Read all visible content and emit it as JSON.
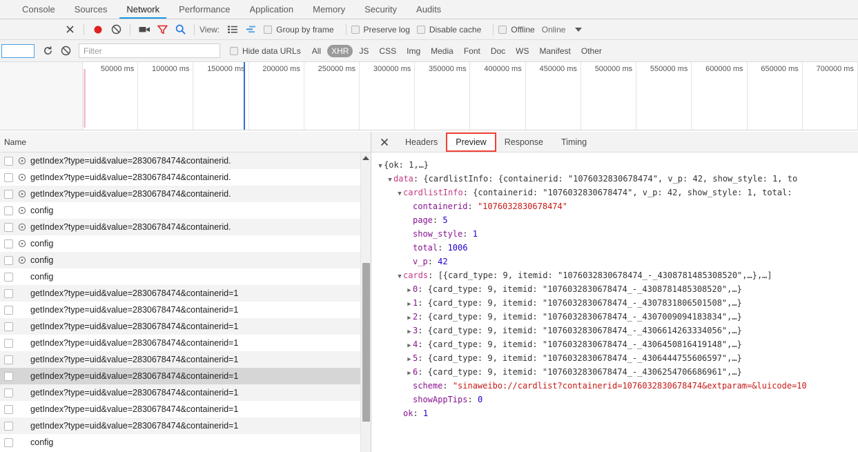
{
  "panel_tabs": [
    {
      "label": "Console",
      "active": false
    },
    {
      "label": "Sources",
      "active": false
    },
    {
      "label": "Network",
      "active": true
    },
    {
      "label": "Performance",
      "active": false
    },
    {
      "label": "Application",
      "active": false
    },
    {
      "label": "Memory",
      "active": false
    },
    {
      "label": "Security",
      "active": false
    },
    {
      "label": "Audits",
      "active": false
    }
  ],
  "toolbar": {
    "close_label": "✕",
    "record_title": "record",
    "clear_title": "clear",
    "capture_screenshots_title": "capture-screenshots",
    "filter_title": "filter",
    "search_title": "search",
    "view_label": "View:",
    "group_by_frame": "Group by frame",
    "preserve_log": "Preserve log",
    "disable_cache": "Disable cache",
    "offline": "Offline",
    "online": "Online"
  },
  "filterbar": {
    "reload_title": "reload",
    "clear_title": "clear",
    "filter_placeholder": "Filter",
    "filter_value": "",
    "hide_data_urls": "Hide data URLs",
    "types": [
      {
        "label": "All",
        "selected": false
      },
      {
        "label": "XHR",
        "selected": true
      },
      {
        "label": "JS",
        "selected": false
      },
      {
        "label": "CSS",
        "selected": false
      },
      {
        "label": "Img",
        "selected": false
      },
      {
        "label": "Media",
        "selected": false
      },
      {
        "label": "Font",
        "selected": false
      },
      {
        "label": "Doc",
        "selected": false
      },
      {
        "label": "WS",
        "selected": false
      },
      {
        "label": "Manifest",
        "selected": false
      },
      {
        "label": "Other",
        "selected": false
      }
    ]
  },
  "overview": {
    "ticks": [
      "50000 ms",
      "100000 ms",
      "150000 ms",
      "200000 ms",
      "250000 ms",
      "300000 ms",
      "350000 ms",
      "400000 ms",
      "450000 ms",
      "500000 ms",
      "550000 ms",
      "600000 ms",
      "650000 ms",
      "700000 ms"
    ]
  },
  "request_list": {
    "column_header": "Name",
    "rows": [
      {
        "name": "getIndex?type=uid&value=2830678474&containerid.",
        "has_icon": true,
        "selected": false
      },
      {
        "name": "getIndex?type=uid&value=2830678474&containerid.",
        "has_icon": true,
        "selected": false
      },
      {
        "name": "getIndex?type=uid&value=2830678474&containerid.",
        "has_icon": true,
        "selected": false
      },
      {
        "name": "config",
        "has_icon": true,
        "selected": false
      },
      {
        "name": "getIndex?type=uid&value=2830678474&containerid.",
        "has_icon": true,
        "selected": false
      },
      {
        "name": "config",
        "has_icon": true,
        "selected": false
      },
      {
        "name": "config",
        "has_icon": true,
        "selected": false
      },
      {
        "name": "config",
        "has_icon": false,
        "selected": false
      },
      {
        "name": "getIndex?type=uid&value=2830678474&containerid=1",
        "has_icon": false,
        "selected": false
      },
      {
        "name": "getIndex?type=uid&value=2830678474&containerid=1",
        "has_icon": false,
        "selected": false
      },
      {
        "name": "getIndex?type=uid&value=2830678474&containerid=1",
        "has_icon": false,
        "selected": false
      },
      {
        "name": "getIndex?type=uid&value=2830678474&containerid=1",
        "has_icon": false,
        "selected": false
      },
      {
        "name": "getIndex?type=uid&value=2830678474&containerid=1",
        "has_icon": false,
        "selected": false
      },
      {
        "name": "getIndex?type=uid&value=2830678474&containerid=1",
        "has_icon": false,
        "selected": true
      },
      {
        "name": "getIndex?type=uid&value=2830678474&containerid=1",
        "has_icon": false,
        "selected": false
      },
      {
        "name": "getIndex?type=uid&value=2830678474&containerid=1",
        "has_icon": false,
        "selected": false
      },
      {
        "name": "getIndex?type=uid&value=2830678474&containerid=1",
        "has_icon": false,
        "selected": false
      },
      {
        "name": "config",
        "has_icon": false,
        "selected": false
      }
    ]
  },
  "detail": {
    "close_label": "✕",
    "tabs": [
      {
        "label": "Headers",
        "active": false,
        "highlighted": false
      },
      {
        "label": "Preview",
        "active": true,
        "highlighted": true
      },
      {
        "label": "Response",
        "active": false,
        "highlighted": false
      },
      {
        "label": "Timing",
        "active": false,
        "highlighted": false
      }
    ],
    "preview_lines": [
      {
        "indent": 0,
        "tri": "open",
        "parts": [
          {
            "t": "{ok: 1,…}",
            "c": "k-pl"
          }
        ]
      },
      {
        "indent": 1,
        "tri": "open",
        "parts": [
          {
            "t": "data",
            "c": "k-name"
          },
          {
            "t": ": {cardlistInfo: {containerid: \"1076032830678474\", v_p: 42, show_style: 1, to",
            "c": "k-pl"
          }
        ]
      },
      {
        "indent": 2,
        "tri": "open",
        "parts": [
          {
            "t": "cardlistInfo",
            "c": "k-name"
          },
          {
            "t": ": {containerid: \"1076032830678474\", v_p: 42, show_style: 1, total:",
            "c": "k-pl"
          }
        ]
      },
      {
        "indent": 3,
        "tri": "pad",
        "parts": [
          {
            "t": "containerid",
            "c": "k-key"
          },
          {
            "t": ": ",
            "c": "k-pl"
          },
          {
            "t": "\"1076032830678474\"",
            "c": "k-str"
          }
        ]
      },
      {
        "indent": 3,
        "tri": "pad",
        "parts": [
          {
            "t": "page",
            "c": "k-key"
          },
          {
            "t": ": ",
            "c": "k-pl"
          },
          {
            "t": "5",
            "c": "k-num"
          }
        ]
      },
      {
        "indent": 3,
        "tri": "pad",
        "parts": [
          {
            "t": "show_style",
            "c": "k-key"
          },
          {
            "t": ": ",
            "c": "k-pl"
          },
          {
            "t": "1",
            "c": "k-num"
          }
        ]
      },
      {
        "indent": 3,
        "tri": "pad",
        "parts": [
          {
            "t": "total",
            "c": "k-key"
          },
          {
            "t": ": ",
            "c": "k-pl"
          },
          {
            "t": "1006",
            "c": "k-num"
          }
        ]
      },
      {
        "indent": 3,
        "tri": "pad",
        "parts": [
          {
            "t": "v_p",
            "c": "k-key"
          },
          {
            "t": ": ",
            "c": "k-pl"
          },
          {
            "t": "42",
            "c": "k-num"
          }
        ]
      },
      {
        "indent": 2,
        "tri": "open",
        "parts": [
          {
            "t": "cards",
            "c": "k-name"
          },
          {
            "t": ": [{card_type: 9, itemid: \"1076032830678474_-_4308781485308520\",…},…]",
            "c": "k-pl"
          }
        ]
      },
      {
        "indent": 3,
        "tri": "closed",
        "parts": [
          {
            "t": "0",
            "c": "k-idx"
          },
          {
            "t": ": {card_type: 9, itemid: \"1076032830678474_-_4308781485308520\",…}",
            "c": "k-pl"
          }
        ]
      },
      {
        "indent": 3,
        "tri": "closed",
        "parts": [
          {
            "t": "1",
            "c": "k-idx"
          },
          {
            "t": ": {card_type: 9, itemid: \"1076032830678474_-_4307831806501508\",…}",
            "c": "k-pl"
          }
        ]
      },
      {
        "indent": 3,
        "tri": "closed",
        "parts": [
          {
            "t": "2",
            "c": "k-idx"
          },
          {
            "t": ": {card_type: 9, itemid: \"1076032830678474_-_4307009094183834\",…}",
            "c": "k-pl"
          }
        ]
      },
      {
        "indent": 3,
        "tri": "closed",
        "parts": [
          {
            "t": "3",
            "c": "k-idx"
          },
          {
            "t": ": {card_type: 9, itemid: \"1076032830678474_-_4306614263334056\",…}",
            "c": "k-pl"
          }
        ]
      },
      {
        "indent": 3,
        "tri": "closed",
        "parts": [
          {
            "t": "4",
            "c": "k-idx"
          },
          {
            "t": ": {card_type: 9, itemid: \"1076032830678474_-_4306450816419148\",…}",
            "c": "k-pl"
          }
        ]
      },
      {
        "indent": 3,
        "tri": "closed",
        "parts": [
          {
            "t": "5",
            "c": "k-idx"
          },
          {
            "t": ": {card_type: 9, itemid: \"1076032830678474_-_4306444755606597\",…}",
            "c": "k-pl"
          }
        ]
      },
      {
        "indent": 3,
        "tri": "closed",
        "parts": [
          {
            "t": "6",
            "c": "k-idx"
          },
          {
            "t": ": {card_type: 9, itemid: \"1076032830678474_-_4306254706686961\",…}",
            "c": "k-pl"
          }
        ]
      },
      {
        "indent": 3,
        "tri": "pad",
        "parts": [
          {
            "t": "scheme",
            "c": "k-key"
          },
          {
            "t": ": ",
            "c": "k-pl"
          },
          {
            "t": "\"sinaweibo://cardlist?containerid=1076032830678474&extparam=&luicode=10",
            "c": "k-str"
          }
        ]
      },
      {
        "indent": 3,
        "tri": "pad",
        "parts": [
          {
            "t": "showAppTips",
            "c": "k-key"
          },
          {
            "t": ": ",
            "c": "k-pl"
          },
          {
            "t": "0",
            "c": "k-num"
          }
        ]
      },
      {
        "indent": 2,
        "tri": "pad",
        "parts": [
          {
            "t": "ok",
            "c": "k-key"
          },
          {
            "t": ": ",
            "c": "k-pl"
          },
          {
            "t": "1",
            "c": "k-num"
          }
        ]
      }
    ]
  },
  "colors": {
    "accent": "#1a9ae8",
    "record_active": "#e02020",
    "filter_active": "#e02020",
    "search_active": "#1a73e8",
    "highlight_box": "#ef4136",
    "selected_row": "#d6d6d6"
  }
}
